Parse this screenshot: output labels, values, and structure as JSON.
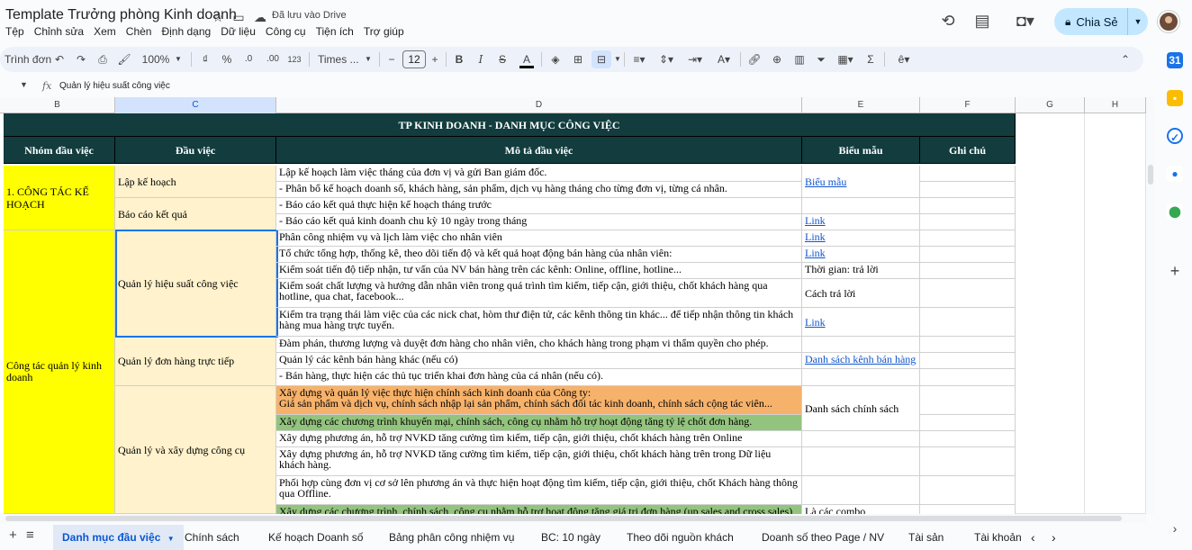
{
  "title_bar": {
    "doc_title": "Template Trưởng phòng Kinh doanh",
    "saved_status": "Đã lưu vào Drive",
    "share_label": "Chia Sẻ"
  },
  "menu": [
    "Tệp",
    "Chỉnh sửa",
    "Xem",
    "Chèn",
    "Định dạng",
    "Dữ liệu",
    "Công cụ",
    "Tiện ích",
    "Trợ giúp"
  ],
  "toolbar": {
    "search_menus": "Trình đơn",
    "zoom": "100%",
    "currency": "₫",
    "percent": "%",
    "decrease_decimal": ".0",
    "increase_decimal": ".00",
    "number_format": "123",
    "font": "Times ...",
    "font_size": "12"
  },
  "formula_bar": {
    "value": "Quản lý hiệu suất công việc"
  },
  "columns": [
    "B",
    "C",
    "D",
    "E",
    "F",
    "G",
    "H"
  ],
  "sheet": {
    "main_title": "TP KINH DOANH - DANH MỤC CÔNG VIỆC",
    "headers": {
      "group": "Nhóm đầu việc",
      "task": "Đầu việc",
      "desc": "Mô tả đầu việc",
      "template": "Biểu mẫu",
      "note": "Ghi chú"
    },
    "groups": {
      "g1": "1. CÔNG TÁC KẾ HOẠCH",
      "g2": "Công tác quản lý kinh doanh"
    },
    "tasks": {
      "t1": "Lập kế hoạch",
      "t2": "Báo cáo kết quả",
      "t3": "Quản lý hiệu suất công việc",
      "t4": "Quản lý đơn hàng trực tiếp",
      "t5": "Quản lý và xây dựng công cụ"
    },
    "rows": [
      {
        "desc": "Lập kế hoạch làm việc tháng của đơn vị và gửi Ban giám đốc.",
        "template": "Biểu mẫu"
      },
      {
        "desc": "- Phân bổ kế hoạch doanh số, khách hàng, sản phẩm, dịch vụ hàng tháng cho từng đơn vị, từng cá nhân.",
        "template": ""
      },
      {
        "desc": "- Báo cáo kết quả thực hiện kế hoạch tháng trước",
        "template": ""
      },
      {
        "desc": "- Báo cáo kết quả kinh doanh chu kỳ 10 ngày trong tháng",
        "template": "Link"
      },
      {
        "desc": "Phân công nhiệm vụ và lịch làm việc cho nhân viên",
        "template": "Link"
      },
      {
        "desc": "Tổ chức tổng hợp, thống kê, theo dõi tiến độ và kết quả hoạt động bán hàng của nhân viên:",
        "template": "Link"
      },
      {
        "desc": "Kiểm soát tiến độ tiếp nhận, tư vấn của NV bán hàng trên các kênh: Online, offline, hotline...",
        "template": "Thời gian: trả lời"
      },
      {
        "desc": "Kiểm soát chất lượng và hướng dẫn nhân viên trong quá trình tìm kiếm, tiếp cận, giới thiệu, chốt khách hàng qua hotline, qua chat, facebook...",
        "template": "Cách trả lời"
      },
      {
        "desc": "Kiểm tra trạng thái làm việc của các nick chat, hòm thư điện tử, các kênh thông tin khác... để tiếp nhận thông tin khách hàng mua hàng trực tuyến.",
        "template": "Link"
      },
      {
        "desc": "Đàm phán, thương lượng và duyệt đơn hàng cho nhân viên, cho khách hàng trong phạm vi thẩm quyền cho phép.",
        "template": ""
      },
      {
        "desc": "Quản lý các kênh bán hàng khác (nếu có)",
        "template": "Danh sách kênh bán hàng"
      },
      {
        "desc": "- Bán hàng, thực hiện các thủ tục triển khai đơn hàng của cá nhân (nếu có).",
        "template": ""
      },
      {
        "desc": "Xây dựng và quản lý việc thực hiện chính sách kinh doanh của Công ty:",
        "desc2": "Giá sản phẩm và dịch vụ, chính sách nhập lại sản phẩm, chính sách đối tác kinh doanh, chính sách cộng tác viên...",
        "template": "Danh sách chính sách"
      },
      {
        "desc": "Xây dựng các chương trình khuyến mại, chính sách, công cụ nhằm hỗ trợ hoạt động tăng tỷ lệ chốt đơn hàng.",
        "template": ""
      },
      {
        "desc": "Xây dựng phương án, hỗ trợ NVKD tăng cường tìm kiếm, tiếp cận, giới thiệu, chốt khách hàng trên Online",
        "template": ""
      },
      {
        "desc": "Xây dựng phương án, hỗ trợ NVKD tăng cường tìm kiếm, tiếp cận, giới thiệu, chốt khách hàng trên trong Dữ liệu khách hàng.",
        "template": ""
      },
      {
        "desc": "Phối hợp cùng đơn vị cơ sở lên phương án và thực hiện hoạt động tìm kiếm, tiếp cận, giới thiệu, chốt Khách hàng thông qua Offline.",
        "template": ""
      },
      {
        "desc": "Xây dựng các chương trình, chính sách, công cụ nhằm hỗ trợ hoạt động tăng giá trị đơn hàng (up sales and cross sales)",
        "template": "Là các combo"
      }
    ]
  },
  "sheet_tabs": [
    "Danh mục đầu việc",
    "Chính sách",
    "Kế hoạch Doanh số",
    "Bảng phân công nhiệm vụ",
    "BC: 10 ngày",
    "Theo dõi nguồn khách",
    "Doanh số theo Page / NV",
    "Tài sản",
    "Tài khoản"
  ],
  "colors": {
    "header_dark": "#123c3e",
    "yellow": "#ffff00",
    "cream": "#fff2cc",
    "orange": "#f6b26b",
    "green": "#93c47d",
    "share_bg": "#c2e7ff"
  }
}
